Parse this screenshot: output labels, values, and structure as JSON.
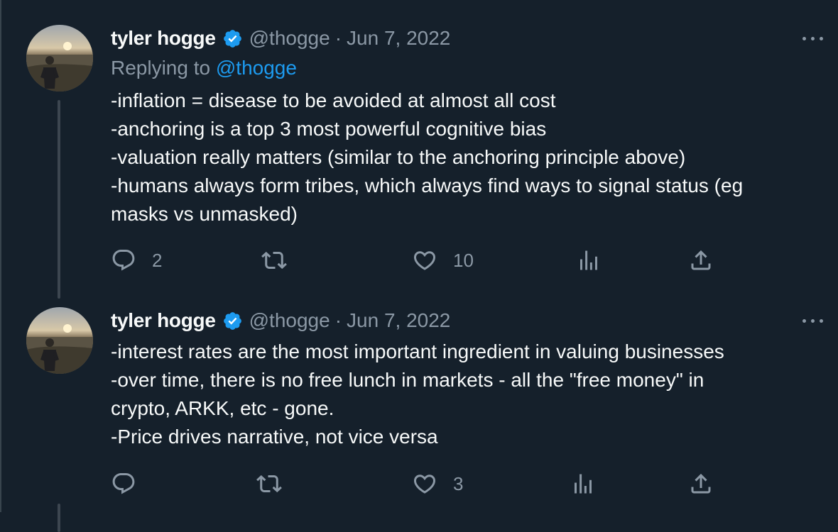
{
  "colors": {
    "background": "#15202b",
    "text": "#f7f9f9",
    "muted": "#8b98a5",
    "accent": "#1d9bf0"
  },
  "tweets": [
    {
      "author": {
        "name": "tyler hogge",
        "handle": "@thogge",
        "verified": true
      },
      "separator": "·",
      "date": "Jun 7, 2022",
      "replying_label": "Replying to",
      "replying_to": "@thogge",
      "lines": [
        "-inflation = disease to be avoided at almost all cost",
        "-anchoring is a top 3 most powerful cognitive bias",
        "-valuation really matters (similar to the anchoring principle above)",
        "-humans always form tribes, which always find ways to signal status (eg",
        "masks vs unmasked)"
      ],
      "actions": {
        "replies": "2",
        "retweets": "",
        "likes": "10"
      },
      "icons": [
        "reply-icon",
        "retweet-icon",
        "like-icon",
        "views-icon",
        "share-icon",
        "more-icon",
        "verified-badge-icon"
      ]
    },
    {
      "author": {
        "name": "tyler hogge",
        "handle": "@thogge",
        "verified": true
      },
      "separator": "·",
      "date": "Jun 7, 2022",
      "lines": [
        "-interest rates are the most important ingredient in valuing businesses",
        "-over time, there is no free lunch in markets - all the \"free money\" in",
        "crypto, ARKK, etc - gone.",
        "-Price drives narrative, not vice versa"
      ],
      "actions": {
        "replies": "",
        "retweets": "",
        "likes": "3"
      },
      "icons": [
        "reply-icon",
        "retweet-icon",
        "like-icon",
        "views-icon",
        "share-icon",
        "more-icon",
        "verified-badge-icon"
      ]
    }
  ]
}
